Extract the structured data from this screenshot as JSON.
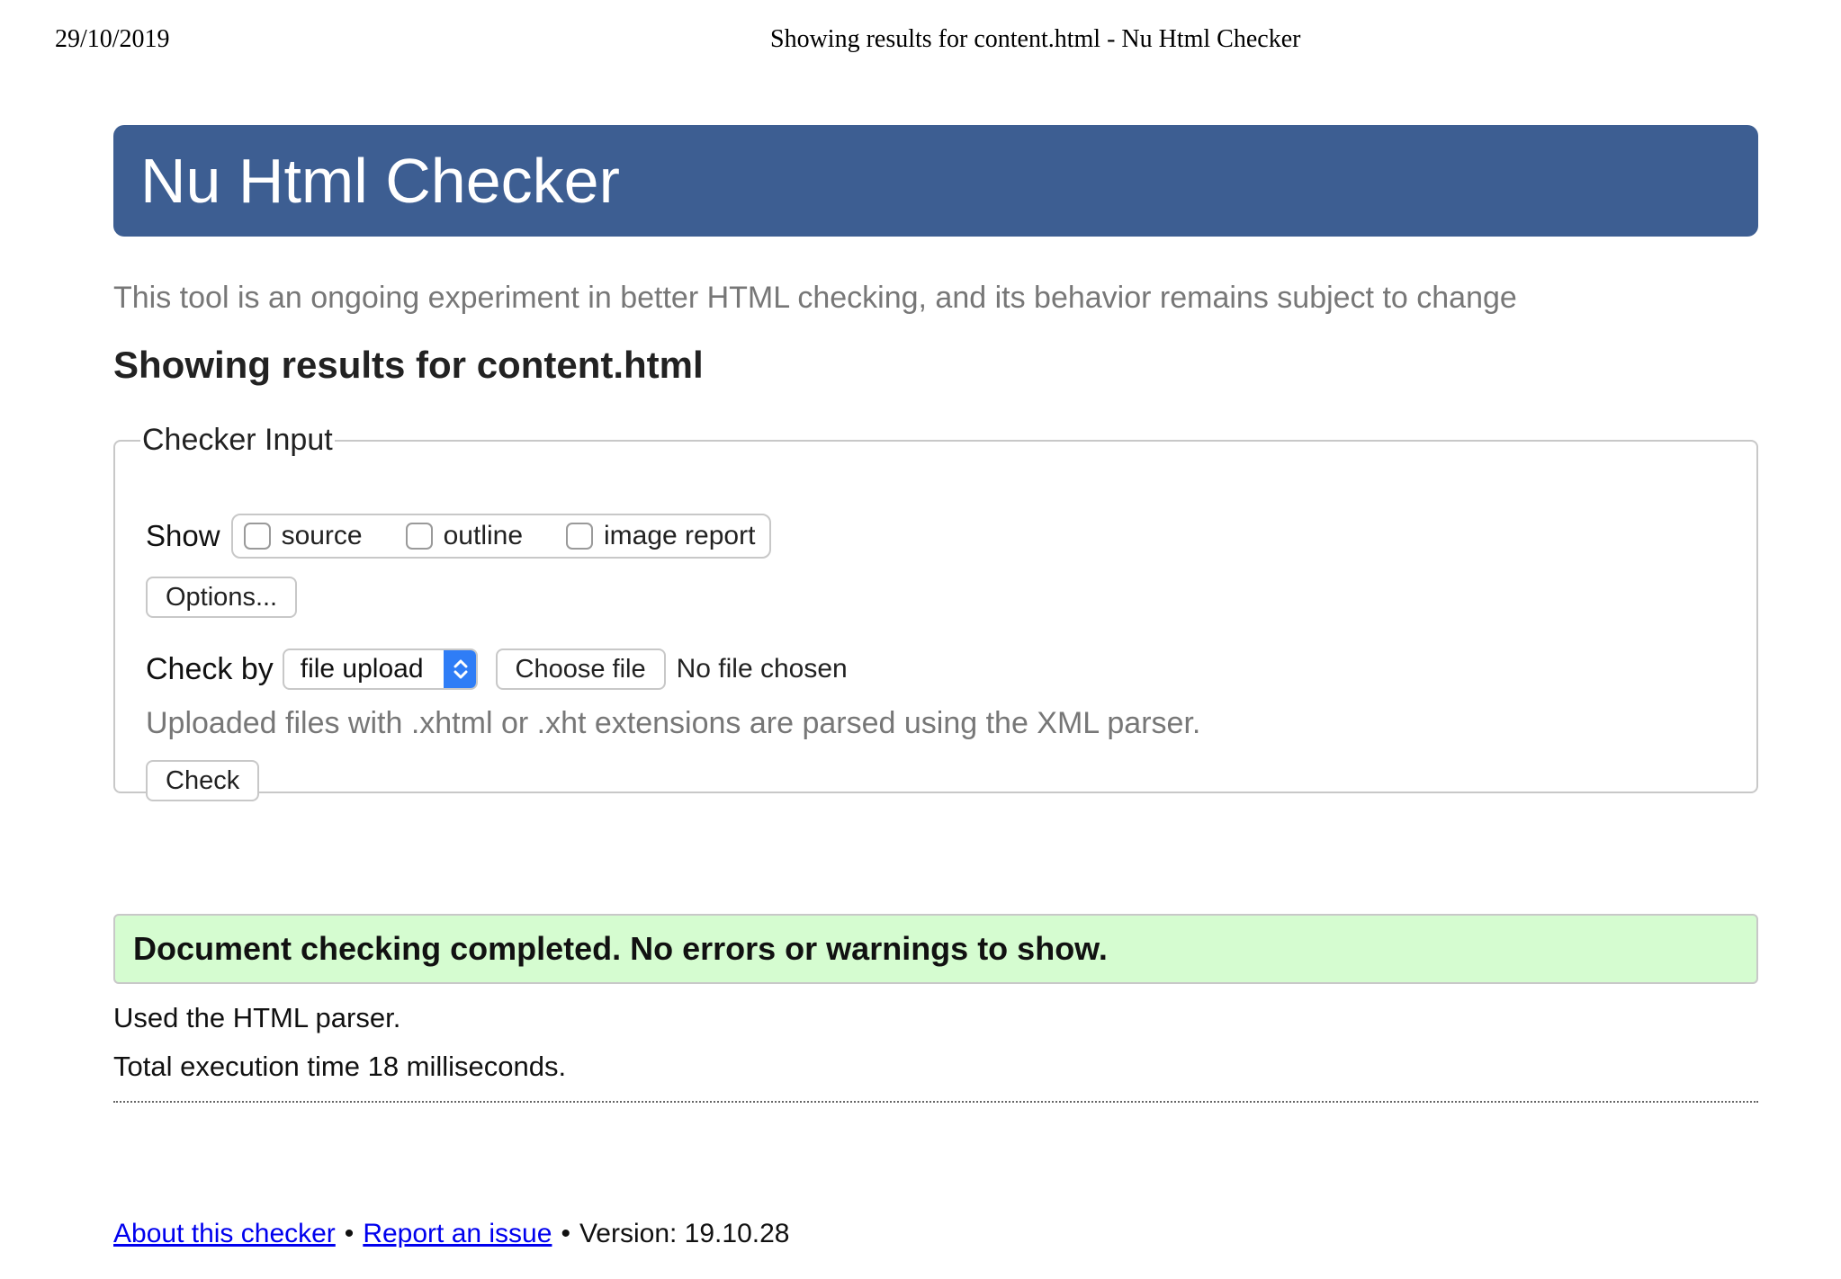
{
  "print_header": {
    "date": "29/10/2019",
    "title": "Showing results for content.html - Nu Html Checker"
  },
  "banner": {
    "title": "Nu Html Checker",
    "background_color": "#3d5e92"
  },
  "tagline": "This tool is an ongoing experiment in better HTML checking, and its behavior remains subject to change",
  "results_heading": "Showing results for content.html",
  "checker_input": {
    "legend": "Checker Input",
    "show_label": "Show",
    "show_options": [
      {
        "label": "source",
        "checked": false
      },
      {
        "label": "outline",
        "checked": false
      },
      {
        "label": "image report",
        "checked": false
      }
    ],
    "options_button": "Options...",
    "check_by_label": "Check by",
    "check_by_value": "file upload",
    "choose_file_button": "Choose file",
    "file_status": "No file chosen",
    "xml_note": "Uploaded files with .xhtml or .xht extensions are parsed using the XML parser.",
    "check_button": "Check"
  },
  "result": {
    "success_message": "Document checking completed. No errors or warnings to show.",
    "success_color": "#d5fcd0",
    "parser_line": "Used the HTML parser.",
    "execution_line": "Total execution time 18 milliseconds."
  },
  "footer": {
    "about_link": "About this checker",
    "separator": "•",
    "report_link": "Report an issue",
    "version": "Version: 19.10.28",
    "link_color": "#0000ee"
  }
}
